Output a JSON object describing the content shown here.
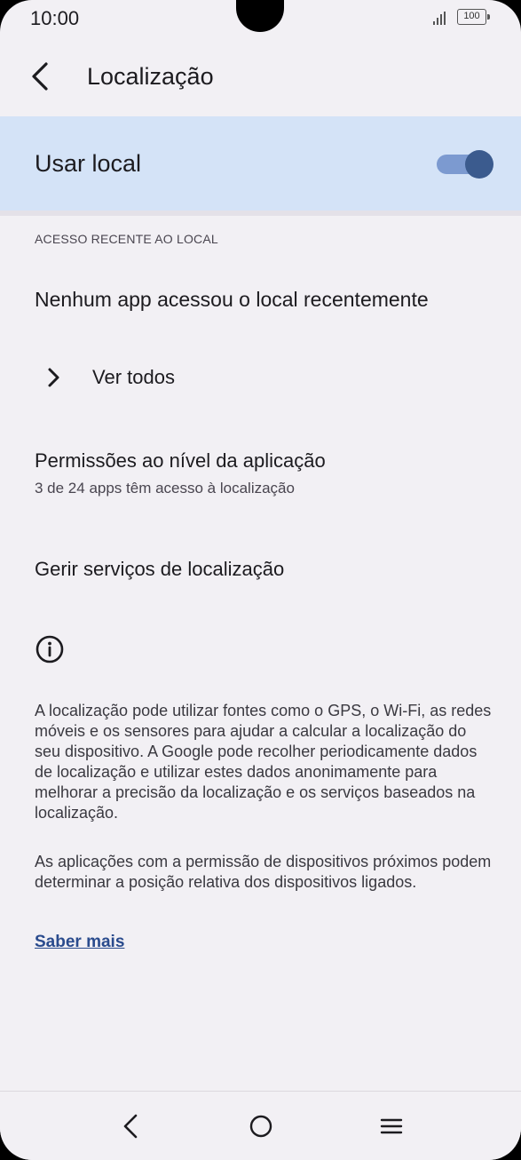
{
  "status_bar": {
    "time": "10:00",
    "battery": "100"
  },
  "header": {
    "title": "Localização"
  },
  "toggle": {
    "label": "Usar local",
    "on": true,
    "accent": "#3b5b8e"
  },
  "recent_access": {
    "section_title": "ACESSO RECENTE AO LOCAL",
    "empty_message": "Nenhum app acessou o local recentemente",
    "see_all": "Ver todos"
  },
  "permissions": {
    "title": "Permissões ao nível da aplicação",
    "subtitle": "3 de 24 apps têm acesso à localização"
  },
  "services": {
    "label": "Gerir serviços de localização"
  },
  "info": {
    "paragraph1": "A localização pode utilizar fontes como o GPS, o Wi-Fi, as redes móveis e os sensores para ajudar a calcular a localização do seu dispositivo. A Google pode recolher periodicamente dados de localização e utilizar estes dados anonimamente para melhorar a precisão da localização e os serviços baseados na localização.",
    "paragraph2": "As aplicações com a permissão de dispositivos próximos podem determinar a posição relativa dos dispositivos ligados.",
    "learn_more": "Saber mais"
  },
  "nav": {
    "back": "back-icon",
    "home": "home-icon",
    "menu": "menu-icon"
  }
}
